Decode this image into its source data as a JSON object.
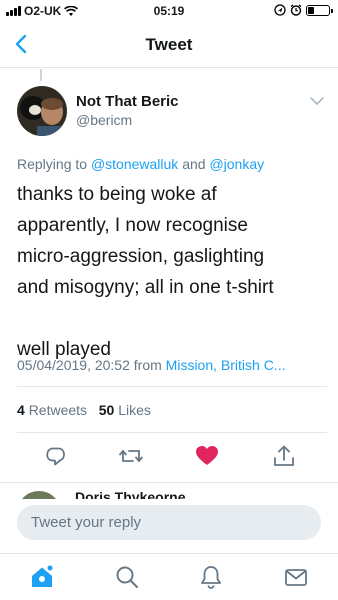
{
  "status_bar": {
    "carrier": "O2-UK",
    "time": "05:19",
    "battery_level": 0.3,
    "icons": [
      "signal-icon",
      "wifi-icon",
      "location-icon",
      "alarm-icon",
      "battery-icon"
    ]
  },
  "nav": {
    "title": "Tweet",
    "back_icon": "chevron-left-icon"
  },
  "tweet": {
    "author_name": "Not That Beric",
    "author_handle": "@bericm",
    "reply_prefix": "Replying to ",
    "mention_1": "@stonewalluk",
    "reply_and": " and ",
    "mention_2": "@jonkay",
    "text": "thanks to being woke af\napparently, I now recognise\nmicro-aggression, gaslighting\nand misogyny; all in one t-shirt\n\nwell played",
    "timestamp": "05/04/2019, 20:52 from ",
    "source": "Mission, British C...",
    "retweets_count": "4",
    "retweets_label": "Retweets",
    "likes_count": "50",
    "likes_label": "Likes"
  },
  "actions": {
    "icons": [
      "reply-icon",
      "retweet-icon",
      "like-icon",
      "share-icon"
    ],
    "like_color": "#e0245e",
    "icon_color": "#1da1f2"
  },
  "next_reply": {
    "name": "Doris Thykeorne"
  },
  "reply_box": {
    "placeholder": "Tweet your reply"
  },
  "tabbar": {
    "icons": [
      "home-icon",
      "search-icon",
      "notifications-icon",
      "messages-icon"
    ],
    "accent": "#1da1f2"
  }
}
